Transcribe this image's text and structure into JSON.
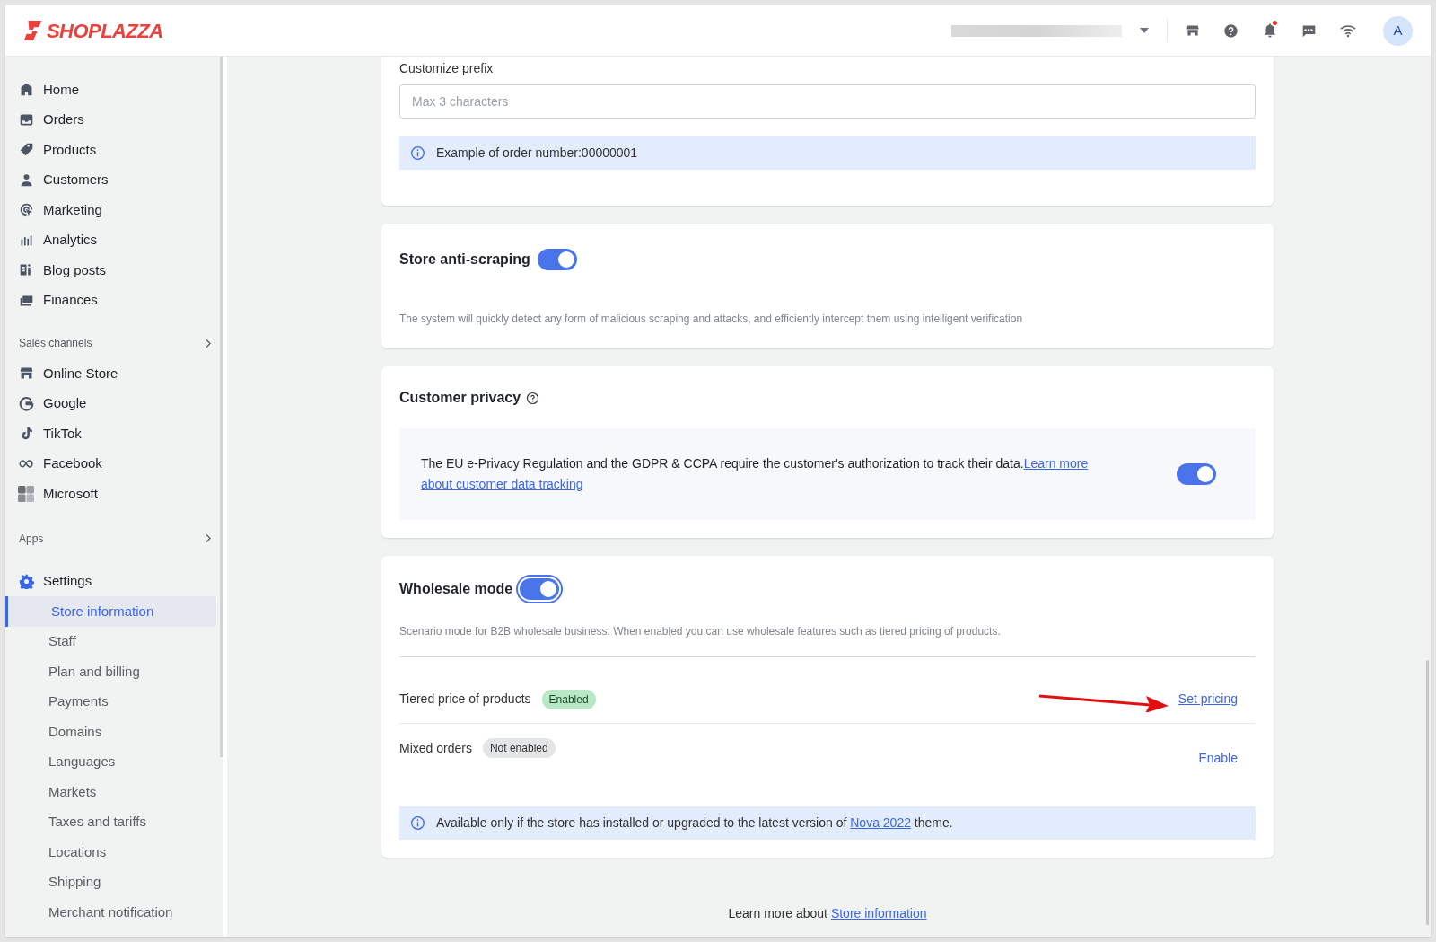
{
  "header": {
    "brand": "SHOPLAZZA",
    "notification_unread": true,
    "avatar": "A"
  },
  "sidebar": {
    "main": [
      {
        "label": "Home"
      },
      {
        "label": "Orders"
      },
      {
        "label": "Products"
      },
      {
        "label": "Customers"
      },
      {
        "label": "Marketing"
      },
      {
        "label": "Analytics"
      },
      {
        "label": "Blog posts"
      },
      {
        "label": "Finances"
      }
    ],
    "sales_channels": {
      "title": "Sales channels",
      "items": [
        {
          "label": "Online Store"
        },
        {
          "label": "Google"
        },
        {
          "label": "TikTok"
        },
        {
          "label": "Facebook"
        },
        {
          "label": "Microsoft"
        }
      ]
    },
    "apps": {
      "title": "Apps"
    },
    "settings": {
      "label": "Settings",
      "children": [
        {
          "label": "Store information",
          "selected": true
        },
        {
          "label": "Staff",
          "selected": false
        },
        {
          "label": "Plan and billing",
          "selected": false
        },
        {
          "label": "Payments",
          "selected": false
        },
        {
          "label": "Domains",
          "selected": false
        },
        {
          "label": "Languages",
          "selected": false
        },
        {
          "label": "Markets",
          "selected": false
        },
        {
          "label": "Taxes and tariffs",
          "selected": false
        },
        {
          "label": "Locations",
          "selected": false
        },
        {
          "label": "Shipping",
          "selected": false
        },
        {
          "label": "Merchant notification",
          "selected": false
        }
      ]
    }
  },
  "prefix": {
    "label": "Customize prefix",
    "placeholder": "Max 3 characters",
    "note": "Example of order number:00000001"
  },
  "anti_scraping": {
    "title": "Store anti-scraping",
    "on": true,
    "description": "The system will quickly detect any form of malicious scraping and attacks, and efficiently intercept them using intelligent verification"
  },
  "customer_privacy": {
    "title": "Customer privacy",
    "text": "The EU e-Privacy Regulation and the GDPR & CCPA require the customer's authorization to track their data.",
    "link_lines": [
      "Learn more",
      "about customer data tracking"
    ],
    "on": true
  },
  "wholesale": {
    "title": "Wholesale mode",
    "on": true,
    "focused": true,
    "description": "Scenario mode for B2B wholesale business. When enabled you can use wholesale features such as tiered pricing of products.",
    "features": [
      {
        "kind": "link",
        "label": "Tiered price of products",
        "badge": "Enabled",
        "enabled": true,
        "action": "Set pricing"
      },
      {
        "kind": "button",
        "label": "Mixed orders",
        "badge": "Not enabled",
        "enabled": false,
        "action": "Enable"
      }
    ],
    "note": {
      "before": "Available only if the store has installed or upgraded to the latest version of",
      "link": "Nova 2022",
      "after": "theme."
    }
  },
  "footer": {
    "text": "Learn more about",
    "link": "Store information"
  }
}
